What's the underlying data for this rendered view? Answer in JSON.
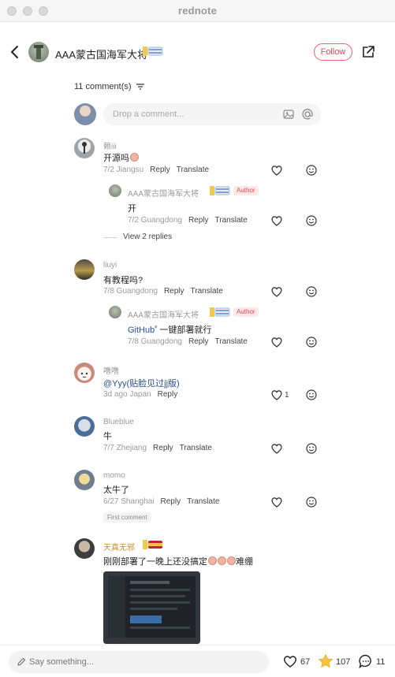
{
  "window": {
    "title": "rednote"
  },
  "header": {
    "author_name": "AAA蒙古国海军大将",
    "follow_label": "Follow"
  },
  "comments_header": {
    "count_label": "11 comment(s)"
  },
  "comment_box": {
    "placeholder": "Drop a comment..."
  },
  "comments": [
    {
      "user": "赖iii",
      "text": "开源吗",
      "date_location": "7/2 Jiangsu",
      "reply_label": "Reply",
      "translate_label": "Translate",
      "replies": [
        {
          "user": "AAA蒙古国海军大将",
          "tag": "Author",
          "text": "开",
          "date_location": "7/2 Guangdong",
          "reply_label": "Reply",
          "translate_label": "Translate"
        }
      ],
      "view_replies_label": "View 2 replies"
    },
    {
      "user": "liuyi",
      "text": "有教程吗?",
      "date_location": "7/8 Guangdong",
      "reply_label": "Reply",
      "translate_label": "Translate",
      "replies": [
        {
          "user": "AAA蒙古国海军大将",
          "tag": "Author",
          "link_text": "GitHub",
          "link_mark": "ᵠ",
          "text": " 一键部署就行",
          "date_location": "7/8 Guangdong",
          "reply_label": "Reply",
          "translate_label": "Translate"
        }
      ]
    },
    {
      "user": "噜噜",
      "text": "@Yyy(贴脸见过jj版)",
      "date_location": "3d ago Japan",
      "reply_label": "Reply",
      "like_count": "1"
    },
    {
      "user": "Blueblue",
      "text": "牛",
      "date_location": "7/7 Zhejiang",
      "reply_label": "Reply",
      "translate_label": "Translate"
    },
    {
      "user": "momo",
      "text": "太牛了",
      "date_location": "6/27 Shanghai",
      "reply_label": "Reply",
      "translate_label": "Translate",
      "tag": "First comment"
    },
    {
      "user": "天真无邪",
      "text": "刚刚部署了一晚上还没搞定",
      "text_tail": "难绷"
    }
  ],
  "bottom_bar": {
    "placeholder": "Say something...",
    "likes": "67",
    "stars": "107",
    "comments": "11"
  },
  "colors": {
    "accent": "#e94656",
    "link": "#2d4f8a",
    "muted": "#9a9a9a"
  },
  "icons": {
    "back": "chevron-left-icon",
    "share": "share-icon",
    "sort": "sort-icon",
    "image": "image-icon",
    "mention": "at-icon",
    "like": "heart-icon",
    "emoji": "smile-icon",
    "edit": "pencil-icon",
    "star": "star-icon",
    "comment": "comment-bubble-icon"
  }
}
